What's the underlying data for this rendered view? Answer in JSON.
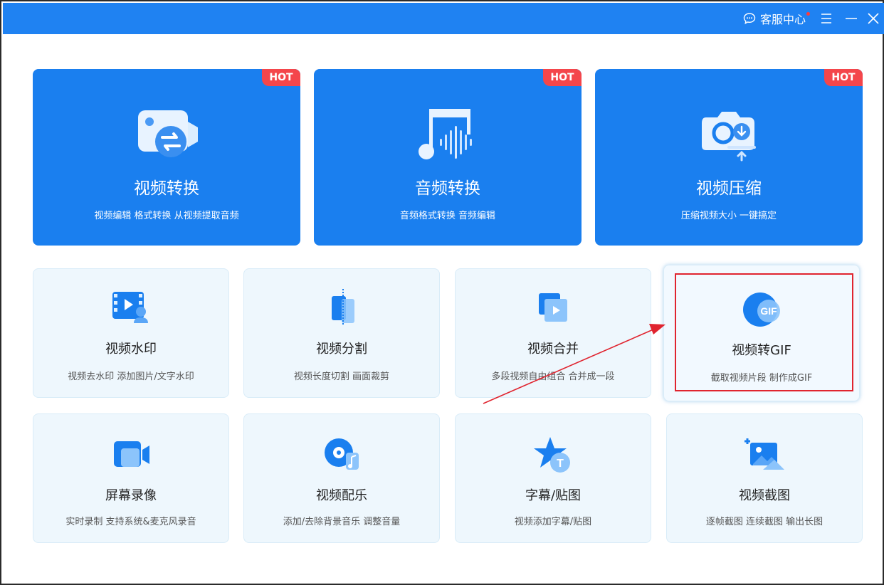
{
  "titlebar": {
    "service_label": "客服中心",
    "colors": {
      "bar": "#1f82f2",
      "badge": "#ff3b3b"
    }
  },
  "hero_cards": [
    {
      "title": "视频转换",
      "desc": "视频编辑 格式转换 从视频提取音频",
      "badge": "HOT",
      "icon": "video-convert-icon"
    },
    {
      "title": "音频转换",
      "desc": "音频格式转换 音频编辑",
      "badge": "HOT",
      "icon": "audio-convert-icon"
    },
    {
      "title": "视频压缩",
      "desc": "压缩视频大小 一键搞定",
      "badge": "HOT",
      "icon": "video-compress-icon"
    }
  ],
  "tools": [
    {
      "title": "视频水印",
      "desc": "视频去水印 添加图片/文字水印",
      "icon": "video-watermark-icon"
    },
    {
      "title": "视频分割",
      "desc": "视频长度切割 画面裁剪",
      "icon": "video-split-icon"
    },
    {
      "title": "视频合并",
      "desc": "多段视频自由组合 合并成一段",
      "icon": "video-merge-icon"
    },
    {
      "title": "视频转GIF",
      "desc": "截取视频片段 制作成GIF",
      "icon": "video-to-gif-icon",
      "gif_text": "GIF"
    },
    {
      "title": "屏幕录像",
      "desc": "实时录制 支持系统&麦克风录音",
      "icon": "screen-record-icon"
    },
    {
      "title": "视频配乐",
      "desc": "添加/去除背景音乐 调整音量",
      "icon": "video-music-icon"
    },
    {
      "title": "字幕/贴图",
      "desc": "视频添加字幕/贴图",
      "icon": "subtitle-sticker-icon",
      "icon_text": "T"
    },
    {
      "title": "视频截图",
      "desc": "逐帧截图 连续截图 输出长图",
      "icon": "video-screenshot-icon"
    }
  ],
  "colors": {
    "hero_bg": "#1a7fef",
    "hot_badge": "#f4464b",
    "tool_bg": "#eef7fd",
    "annotation": "#e0242f"
  }
}
